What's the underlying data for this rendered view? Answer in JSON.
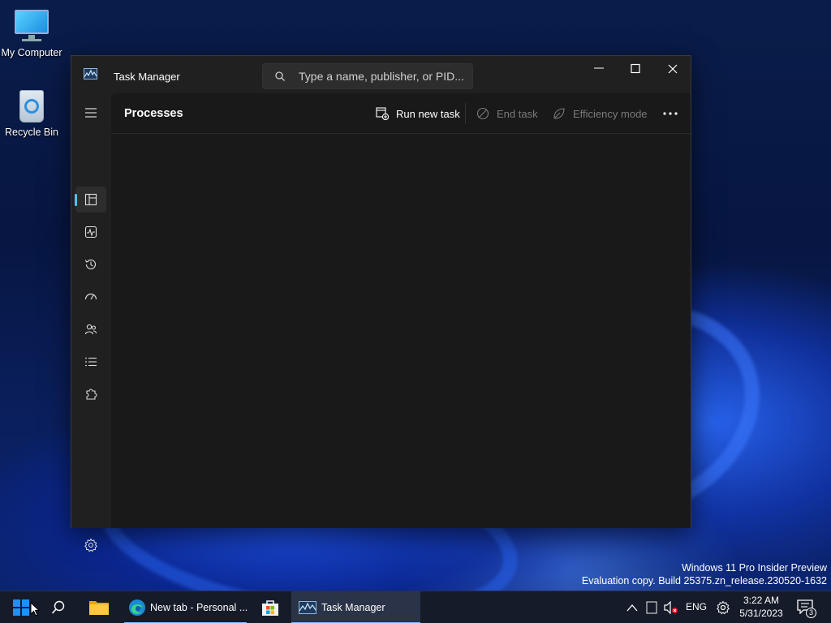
{
  "desktop": {
    "icons": [
      {
        "label": "My Computer"
      },
      {
        "label": "Recycle Bin"
      }
    ],
    "watermark": {
      "line1": "Windows 11 Pro Insider Preview",
      "line2": "Evaluation copy. Build 25375.zn_release.230520-1632"
    }
  },
  "window": {
    "title": "Task Manager",
    "search_placeholder": "Type a name, publisher, or PID...",
    "page_title": "Processes",
    "commands": {
      "run_new_task": "Run new task",
      "end_task": "End task",
      "efficiency_mode": "Efficiency mode"
    },
    "nav_items": [
      "processes",
      "performance",
      "app-history",
      "startup-apps",
      "users",
      "details",
      "services"
    ]
  },
  "taskbar": {
    "apps": [
      {
        "label": "New tab - Personal ..."
      },
      {
        "label": "Task Manager"
      }
    ],
    "language": "ENG",
    "time": "3:22 AM",
    "date": "5/31/2023",
    "notification_count": "3"
  },
  "colors": {
    "accent": "#4cc2ff",
    "window_bg": "#202020",
    "content_bg": "#191919",
    "taskbar_bg": "#151b29"
  }
}
